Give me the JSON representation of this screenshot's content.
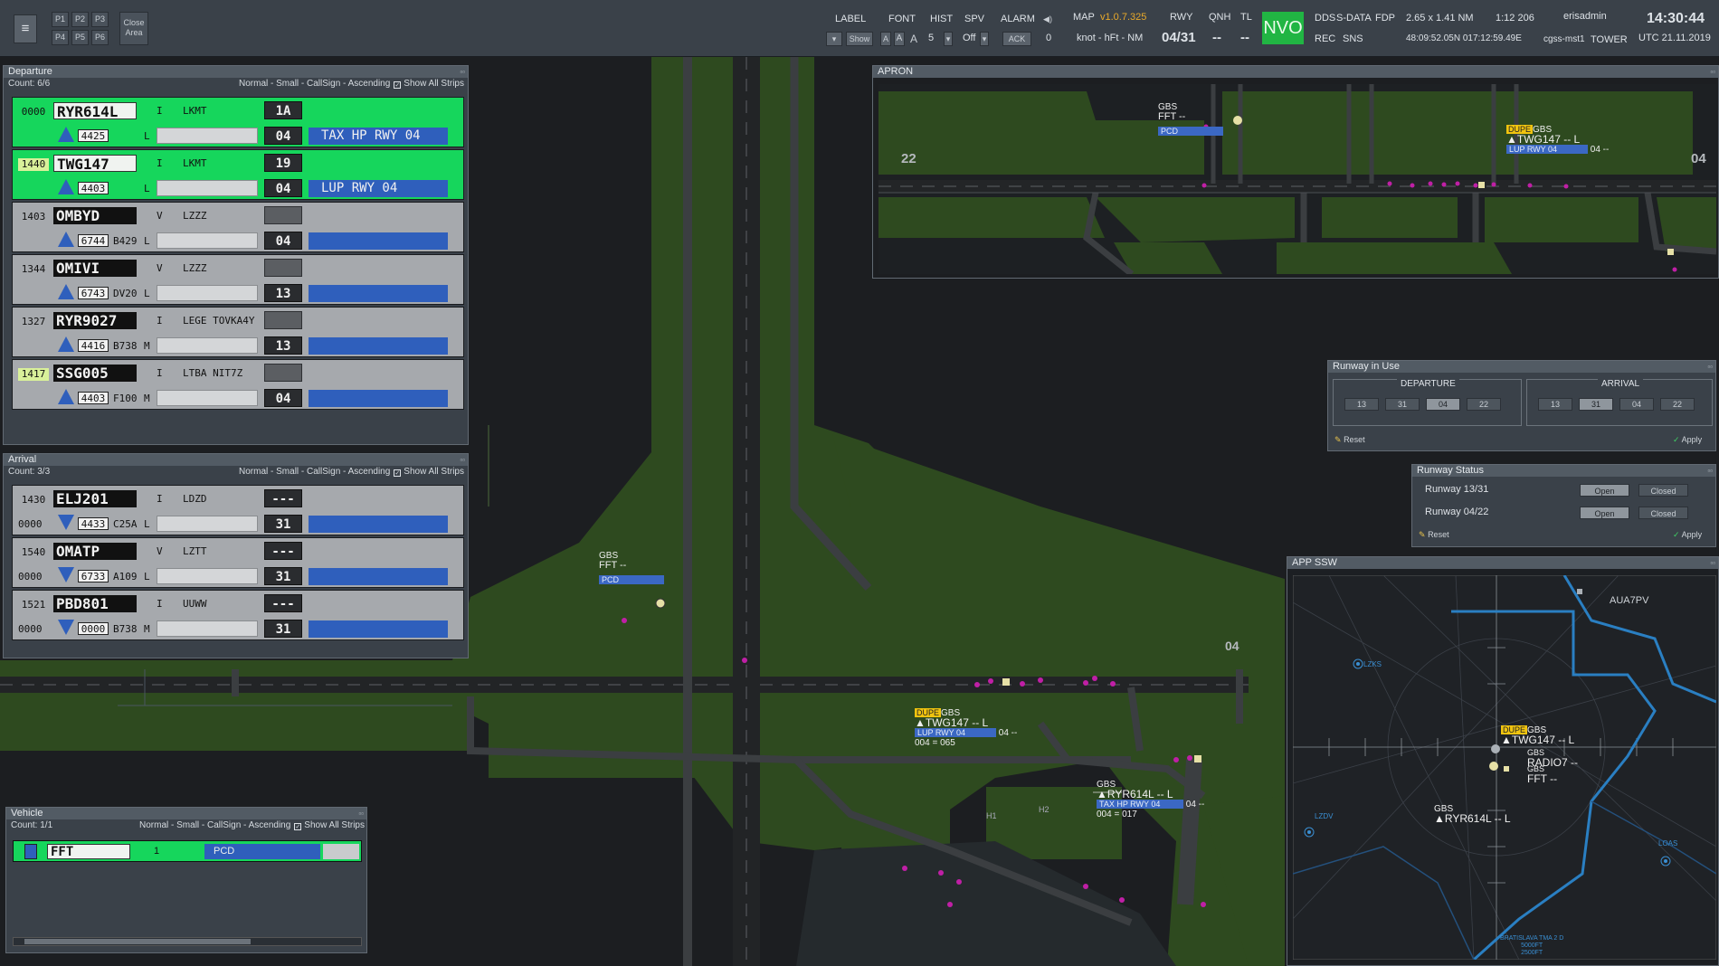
{
  "toolbar": {
    "menu_glyph": "≡",
    "presets": [
      "P1",
      "P2",
      "P3",
      "P4",
      "P5",
      "P6"
    ],
    "close_area": [
      "Close",
      "Area"
    ],
    "label": "LABEL",
    "label_value": "Show",
    "font": "FONT",
    "font_opts": [
      "A",
      "A",
      "A"
    ],
    "hist": "HIST",
    "hist_value": "5",
    "spv": "SPV",
    "spv_value": "Off",
    "alarm": "ALARM",
    "alarm_ack": "ACK",
    "alarm_count": "0",
    "map": "MAP",
    "map_version": "v1.0.7.325",
    "map_units": "knot - hFt - NM",
    "rwy": "RWY",
    "rwy_value": "04/31",
    "qnh": "QNH",
    "qnh_value": "--",
    "tl": "TL",
    "tl_value": "--",
    "nvo": "NVO",
    "dds": "DDS",
    "sdata": "S-DATA",
    "fdp": "FDP",
    "rec": "REC",
    "sns": "SNS",
    "range": "2.65 x 1.41 NM",
    "scale": "1:12 206",
    "coords": "48:09:52.05N 017:12:59.49E",
    "user": "erisadmin",
    "host": "cgss-mst1",
    "role": "TOWER",
    "time": "14:30:44",
    "date": "UTC 21.11.2019",
    "colors": {
      "nvo": "#21b543",
      "version": "#e8a92a"
    }
  },
  "departure": {
    "title": "Departure",
    "count": "Count: 6/6",
    "sort": "Normal - Small - CallSign - Ascending",
    "show_all": "Show All Strips",
    "strips": [
      {
        "code": "0000",
        "callsign": "RYR614L",
        "rule": "I",
        "ades": "LKMT",
        "box": "1A",
        "ssr": "4425",
        "type": "",
        "wtc": "L",
        "rwy": "04",
        "clearance": "TAX HP RWY 04",
        "color": "green",
        "code_hl": false
      },
      {
        "code": "1440",
        "callsign": "TWG147",
        "rule": "I",
        "ades": "LKMT",
        "box": "19",
        "ssr": "4403",
        "type": "",
        "wtc": "L",
        "rwy": "04",
        "clearance": "LUP RWY 04",
        "color": "green",
        "code_hl": true
      },
      {
        "code": "1403",
        "callsign": "OMBYD",
        "rule": "V",
        "ades": "LZZZ",
        "box": "",
        "ssr": "6744",
        "type": "B429",
        "wtc": "L",
        "rwy": "04",
        "clearance": "",
        "color": "grey",
        "code_hl": false
      },
      {
        "code": "1344",
        "callsign": "OMIVI",
        "rule": "V",
        "ades": "LZZZ",
        "box": "",
        "ssr": "6743",
        "type": "DV20",
        "wtc": "L",
        "rwy": "13",
        "clearance": "",
        "color": "grey",
        "code_hl": false
      },
      {
        "code": "1327",
        "callsign": "RYR9027",
        "rule": "I",
        "ades": "LEGE TOVKA4Y",
        "box": "",
        "ssr": "4416",
        "type": "B738",
        "wtc": "M",
        "rwy": "13",
        "clearance": "",
        "color": "grey",
        "code_hl": false
      },
      {
        "code": "1417",
        "callsign": "SSG005",
        "rule": "I",
        "ades": "LTBA NIT7Z",
        "box": "",
        "ssr": "4403",
        "type": "F100",
        "wtc": "M",
        "rwy": "04",
        "clearance": "",
        "color": "grey",
        "code_hl": true
      }
    ]
  },
  "arrival": {
    "title": "Arrival",
    "count": "Count: 3/3",
    "sort": "Normal - Small - CallSign - Ascending",
    "show_all": "Show All Strips",
    "strips": [
      {
        "code_top": "1430",
        "code": "0000",
        "callsign": "ELJ201",
        "rule": "I",
        "ades": "LDZD",
        "box": "---",
        "ssr": "4433",
        "type": "C25A",
        "wtc": "L",
        "rwy": "31"
      },
      {
        "code_top": "1540",
        "code": "0000",
        "callsign": "OMATP",
        "rule": "V",
        "ades": "LZTT",
        "box": "---",
        "ssr": "6733",
        "type": "A109",
        "wtc": "L",
        "rwy": "31"
      },
      {
        "code_top": "1521",
        "code": "0000",
        "callsign": "PBD801",
        "rule": "I",
        "ades": "UUWW",
        "box": "---",
        "ssr": "0000",
        "type": "B738",
        "wtc": "M",
        "rwy": "31"
      }
    ]
  },
  "vehicle": {
    "title": "Vehicle",
    "count": "Count: 1/1",
    "sort": "Normal - Small - CallSign - Ascending",
    "show_all": "Show All Strips",
    "strip": {
      "callsign": "FFT",
      "num": "1",
      "area": "PCD"
    }
  },
  "apron": {
    "title": "APRON",
    "rwy_left": "22",
    "rwy_right": "04",
    "fft": {
      "line1": "GBS",
      "line2": "FFT --",
      "tag": "PCD"
    },
    "twg": {
      "dupe": "DUPE",
      "gbs": "GBS",
      "line2": "▲TWG147 -- L",
      "tag": "LUP RWY 04",
      "alt": "04 --"
    }
  },
  "runway_in_use": {
    "title": "Runway in Use",
    "departure": "DEPARTURE",
    "arrival": "ARRIVAL",
    "dep_buttons": [
      "13",
      "31",
      "04",
      "22"
    ],
    "arr_buttons": [
      "13",
      "31",
      "04",
      "22"
    ],
    "dep_selected": "04",
    "arr_selected": "31",
    "reset": "Reset",
    "apply": "Apply"
  },
  "runway_status": {
    "title": "Runway Status",
    "rows": [
      {
        "name": "Runway  13/31",
        "open": "Open",
        "closed": "Closed"
      },
      {
        "name": "Runway  04/22",
        "open": "Open",
        "closed": "Closed"
      }
    ],
    "reset": "Reset",
    "apply": "Apply"
  },
  "app_ssw": {
    "title": "APP SSW",
    "fix": "AUA7PV",
    "twg": {
      "dupe": "DUPE",
      "gbs": "GBS",
      "line2": "▲TWG147 -- L"
    },
    "radio": {
      "gbs": "GBS",
      "line2": "RADIO7 --"
    },
    "fft": {
      "gbs": "GBS",
      "line2": "FFT --"
    },
    "ryr": {
      "gbs": "GBS",
      "line2": "▲RYR614L -- L"
    },
    "tma": [
      "BRATISLAVA TMA 2 D",
      "5000FT",
      "2500FT"
    ],
    "fixes": [
      "LZKS",
      "LZDV",
      "LOAS"
    ]
  },
  "map": {
    "rwy_label": "04",
    "fft": {
      "gbs": "GBS",
      "line2": "FFT --",
      "tag": "PCD"
    },
    "twg": {
      "dupe": "DUPE",
      "gbs": "GBS",
      "line2": "▲TWG147 -- L",
      "tag": "LUP RWY 04",
      "alt": "04 --",
      "line4": "004 = 065"
    },
    "ryr": {
      "gbs": "GBS",
      "line2": "▲RYR614L -- L",
      "tag": "TAX HP RWY 04",
      "alt": "04 --",
      "line4": "004 = 017"
    },
    "taxi_labels": [
      "H1",
      "H2"
    ]
  }
}
